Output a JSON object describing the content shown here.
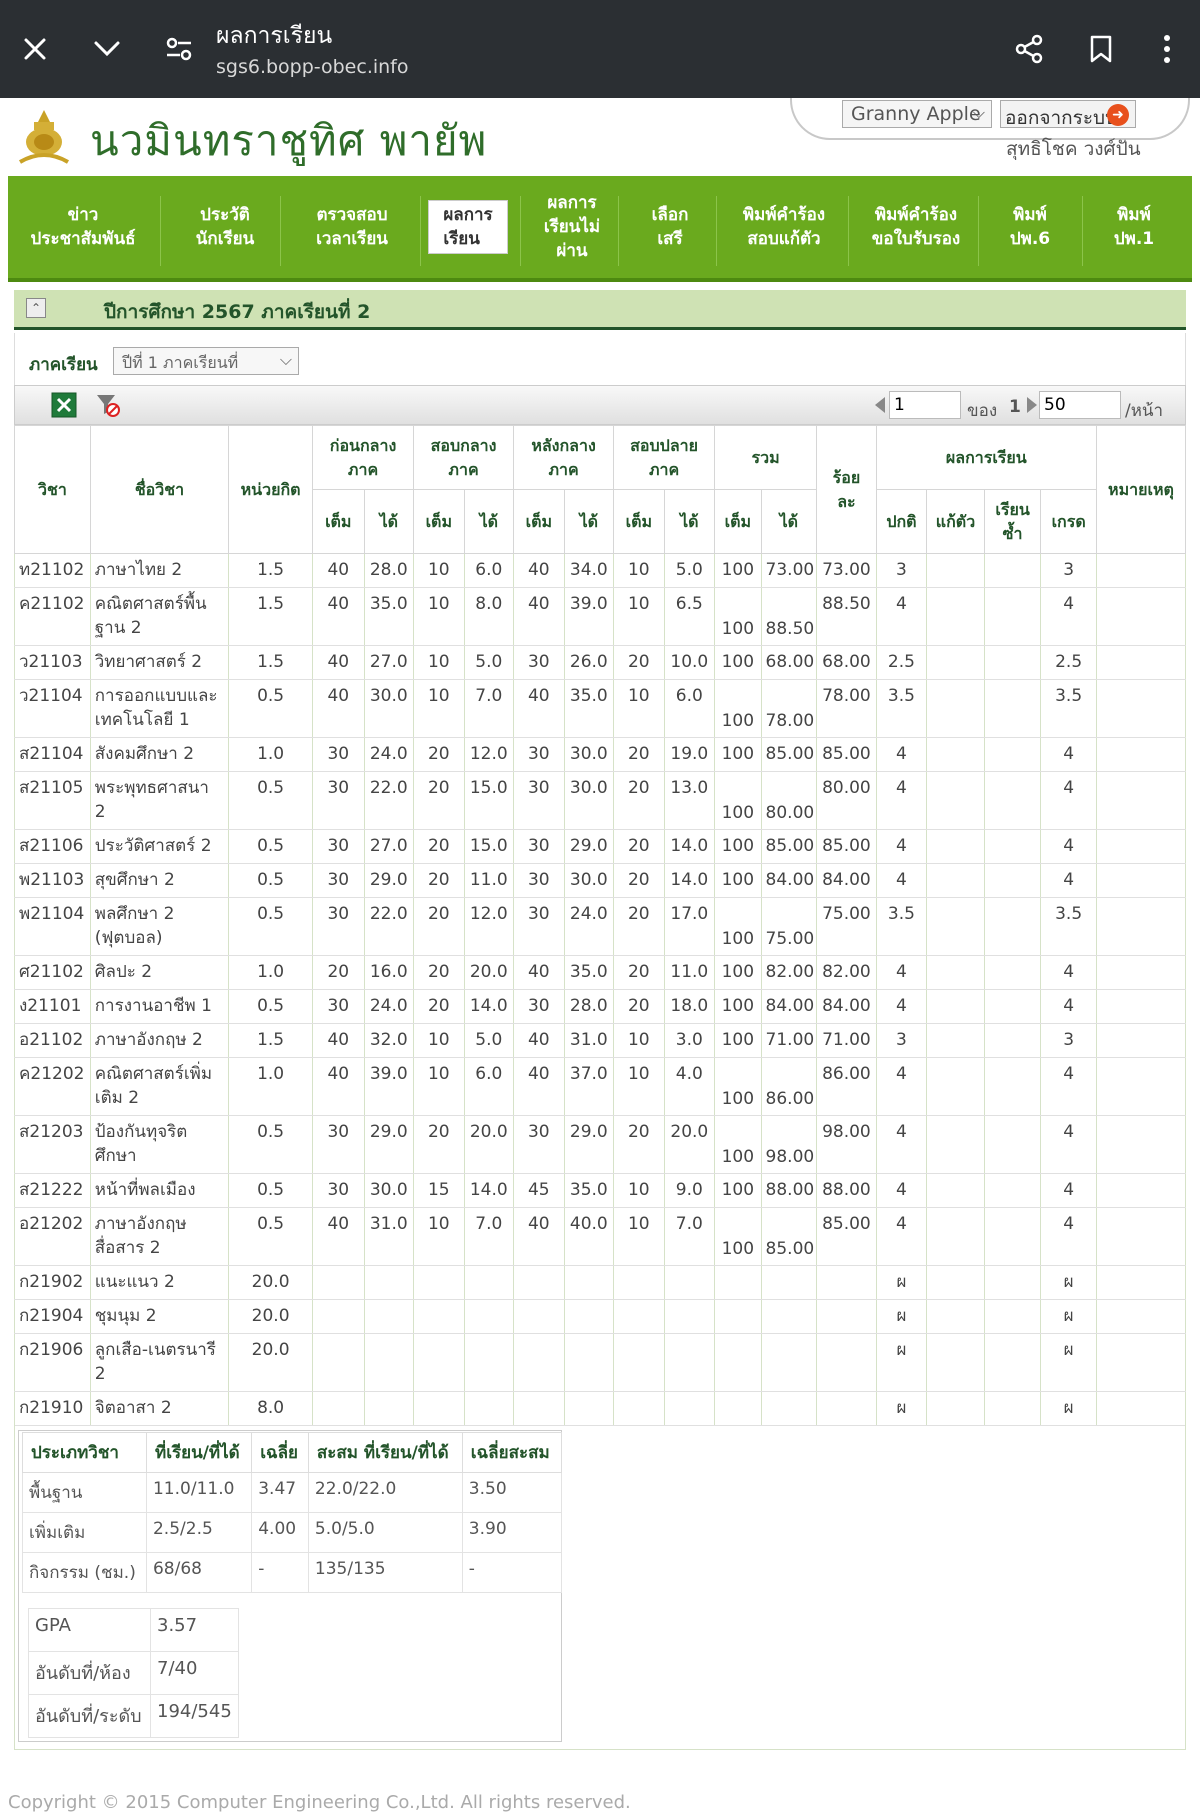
{
  "browser": {
    "title": "ผลการเรียน",
    "url": "sgs6.bopp-obec.info",
    "icons": [
      "close-icon",
      "chevron-down-icon",
      "page-settings-icon",
      "share-icon",
      "bookmark-icon",
      "more-vert-icon"
    ]
  },
  "header": {
    "school_name": "นวมินทราชูทิศ พายัพ",
    "theme": "Granny Apple",
    "logout_label": "ออกจากระบบ",
    "user_name": "สุทธิโชค วงศ์ปัน"
  },
  "nav": [
    {
      "label": "ข่าว\nประชาสัมพันธ์"
    },
    {
      "label": "ประวัติ\nนักเรียน"
    },
    {
      "label": "ตรวจสอบ\nเวลาเรียน"
    },
    {
      "label": "ผลการ\nเรียน",
      "active": true
    },
    {
      "label": "ผลการ\nเรียนไม่\nผ่าน"
    },
    {
      "label": "เลือก\nเสรี"
    },
    {
      "label": "พิมพ์คำร้อง\nสอบแก้ตัว"
    },
    {
      "label": "พิมพ์คำร้อง\nขอใบรับรอง"
    },
    {
      "label": "พิมพ์\nปพ.6"
    },
    {
      "label": "พิมพ์\nปพ.1"
    }
  ],
  "section": {
    "title": "ปีการศึกษา 2567 ภาคเรียนที่ 2",
    "term_label": "ภาคเรียน",
    "term_value": "ปีที่ 1 ภาคเรียนที่"
  },
  "pager": {
    "page": "1",
    "of_label": "ของ",
    "total": "1",
    "per_page": "50",
    "per_page_suffix": "/หน้า"
  },
  "table": {
    "headers": {
      "code": "วิชา",
      "name": "ชื่อวิชา",
      "credit": "หน่วยกิต",
      "pre_mid": "ก่อนกลาง\nภาค",
      "mid": "สอบกลาง\nภาค",
      "post_mid": "หลังกลาง\nภาค",
      "final": "สอบปลาย\nภาค",
      "total": "รวม",
      "percent": "ร้อย\nละ",
      "result": "ผลการเรียน",
      "remark": "หมายเหตุ",
      "full": "เต็ม",
      "got": "ได้",
      "normal": "ปกติ",
      "retest": "แก้ตัว",
      "repeat": "เรียน\nซ้ำ",
      "grade": "เกรด"
    },
    "rows": [
      {
        "code": "ท21102",
        "name": "ภาษาไทย 2",
        "credit": "1.5",
        "s": [
          "40",
          "28.0",
          "10",
          "6.0",
          "40",
          "34.0",
          "10",
          "5.0",
          "100",
          "73.00"
        ],
        "pct": "73.00",
        "normal": "3",
        "grade": "3",
        "two": false
      },
      {
        "code": "ค21102",
        "name": "คณิตศาสตร์พื้นฐาน 2",
        "credit": "1.5",
        "s": [
          "40",
          "35.0",
          "10",
          "8.0",
          "40",
          "39.0",
          "10",
          "6.5",
          "100",
          "88.50"
        ],
        "pct": "88.50",
        "normal": "4",
        "grade": "4",
        "two": true
      },
      {
        "code": "ว21103",
        "name": "วิทยาศาสตร์ 2",
        "credit": "1.5",
        "s": [
          "40",
          "27.0",
          "10",
          "5.0",
          "30",
          "26.0",
          "20",
          "10.0",
          "100",
          "68.00"
        ],
        "pct": "68.00",
        "normal": "2.5",
        "grade": "2.5",
        "two": false
      },
      {
        "code": "ว21104",
        "name": "การออกแบบและเทคโนโลยี 1",
        "credit": "0.5",
        "s": [
          "40",
          "30.0",
          "10",
          "7.0",
          "40",
          "35.0",
          "10",
          "6.0",
          "100",
          "78.00"
        ],
        "pct": "78.00",
        "normal": "3.5",
        "grade": "3.5",
        "two": true
      },
      {
        "code": "ส21104",
        "name": "สังคมศึกษา 2",
        "credit": "1.0",
        "s": [
          "30",
          "24.0",
          "20",
          "12.0",
          "30",
          "30.0",
          "20",
          "19.0",
          "100",
          "85.00"
        ],
        "pct": "85.00",
        "normal": "4",
        "grade": "4",
        "two": false
      },
      {
        "code": "ส21105",
        "name": "พระพุทธศาสนา 2",
        "credit": "0.5",
        "s": [
          "30",
          "22.0",
          "20",
          "15.0",
          "30",
          "30.0",
          "20",
          "13.0",
          "100",
          "80.00"
        ],
        "pct": "80.00",
        "normal": "4",
        "grade": "4",
        "two": true
      },
      {
        "code": "ส21106",
        "name": "ประวัติศาสตร์ 2",
        "credit": "0.5",
        "s": [
          "30",
          "27.0",
          "20",
          "15.0",
          "30",
          "29.0",
          "20",
          "14.0",
          "100",
          "85.00"
        ],
        "pct": "85.00",
        "normal": "4",
        "grade": "4",
        "two": false
      },
      {
        "code": "พ21103",
        "name": "สุขศึกษา 2",
        "credit": "0.5",
        "s": [
          "30",
          "29.0",
          "20",
          "11.0",
          "30",
          "30.0",
          "20",
          "14.0",
          "100",
          "84.00"
        ],
        "pct": "84.00",
        "normal": "4",
        "grade": "4",
        "two": false
      },
      {
        "code": "พ21104",
        "name": "พลศึกษา 2 (ฟุตบอล)",
        "credit": "0.5",
        "s": [
          "30",
          "22.0",
          "20",
          "12.0",
          "30",
          "24.0",
          "20",
          "17.0",
          "100",
          "75.00"
        ],
        "pct": "75.00",
        "normal": "3.5",
        "grade": "3.5",
        "two": true
      },
      {
        "code": "ศ21102",
        "name": "ศิลปะ 2",
        "credit": "1.0",
        "s": [
          "20",
          "16.0",
          "20",
          "20.0",
          "40",
          "35.0",
          "20",
          "11.0",
          "100",
          "82.00"
        ],
        "pct": "82.00",
        "normal": "4",
        "grade": "4",
        "two": false
      },
      {
        "code": "ง21101",
        "name": "การงานอาชีพ 1",
        "credit": "0.5",
        "s": [
          "30",
          "24.0",
          "20",
          "14.0",
          "30",
          "28.0",
          "20",
          "18.0",
          "100",
          "84.00"
        ],
        "pct": "84.00",
        "normal": "4",
        "grade": "4",
        "two": false
      },
      {
        "code": "อ21102",
        "name": "ภาษาอังกฤษ 2",
        "credit": "1.5",
        "s": [
          "40",
          "32.0",
          "10",
          "5.0",
          "40",
          "31.0",
          "10",
          "3.0",
          "100",
          "71.00"
        ],
        "pct": "71.00",
        "normal": "3",
        "grade": "3",
        "two": false
      },
      {
        "code": "ค21202",
        "name": "คณิตศาสตร์เพิ่มเติม 2",
        "credit": "1.0",
        "s": [
          "40",
          "39.0",
          "10",
          "6.0",
          "40",
          "37.0",
          "10",
          "4.0",
          "100",
          "86.00"
        ],
        "pct": "86.00",
        "normal": "4",
        "grade": "4",
        "two": true
      },
      {
        "code": "ส21203",
        "name": "ป้องกันทุจริตศึกษา",
        "credit": "0.5",
        "s": [
          "30",
          "29.0",
          "20",
          "20.0",
          "30",
          "29.0",
          "20",
          "20.0",
          "100",
          "98.00"
        ],
        "pct": "98.00",
        "normal": "4",
        "grade": "4",
        "two": true
      },
      {
        "code": "ส21222",
        "name": "หน้าที่พลเมือง",
        "credit": "0.5",
        "s": [
          "30",
          "30.0",
          "15",
          "14.0",
          "45",
          "35.0",
          "10",
          "9.0",
          "100",
          "88.00"
        ],
        "pct": "88.00",
        "normal": "4",
        "grade": "4",
        "two": false
      },
      {
        "code": "อ21202",
        "name": "ภาษาอังกฤษสื่อสาร 2",
        "credit": "0.5",
        "s": [
          "40",
          "31.0",
          "10",
          "7.0",
          "40",
          "40.0",
          "10",
          "7.0",
          "100",
          "85.00"
        ],
        "pct": "85.00",
        "normal": "4",
        "grade": "4",
        "two": true
      },
      {
        "code": "ก21902",
        "name": "แนะแนว 2",
        "credit": "20.0",
        "s": [
          "",
          "",
          "",
          "",
          "",
          "",
          "",
          "",
          "",
          ""
        ],
        "pct": "",
        "normal": "ผ",
        "grade": "ผ",
        "two": false
      },
      {
        "code": "ก21904",
        "name": "ชุมนุม 2",
        "credit": "20.0",
        "s": [
          "",
          "",
          "",
          "",
          "",
          "",
          "",
          "",
          "",
          ""
        ],
        "pct": "",
        "normal": "ผ",
        "grade": "ผ",
        "two": false
      },
      {
        "code": "ก21906",
        "name": "ลูกเสือ-เนตรนารี 2",
        "credit": "20.0",
        "s": [
          "",
          "",
          "",
          "",
          "",
          "",
          "",
          "",
          "",
          ""
        ],
        "pct": "",
        "normal": "ผ",
        "grade": "ผ",
        "two": true
      },
      {
        "code": "ก21910",
        "name": "จิตอาสา 2",
        "credit": "8.0",
        "s": [
          "",
          "",
          "",
          "",
          "",
          "",
          "",
          "",
          "",
          ""
        ],
        "pct": "",
        "normal": "ผ",
        "grade": "ผ",
        "two": false
      }
    ]
  },
  "summary": {
    "headers": [
      "ประเภทวิชา",
      "ที่เรียน/ที่ได้",
      "เฉลี่ย",
      "สะสม ที่เรียน/ที่ได้",
      "เฉลี่ยสะสม"
    ],
    "rows": [
      [
        "พื้นฐาน",
        "11.0/11.0",
        "3.47",
        "22.0/22.0",
        "3.50"
      ],
      [
        "เพิ่มเติม",
        "2.5/2.5",
        "4.00",
        "5.0/5.0",
        "3.90"
      ],
      [
        "กิจกรรม (ชม.)",
        "68/68",
        "-",
        "135/135",
        "-"
      ]
    ],
    "gpa": [
      [
        "GPA",
        "3.57"
      ],
      [
        "อันดับที่/ห้อง",
        "7/40"
      ],
      [
        "อันดับที่/ระดับ",
        "194/545"
      ]
    ]
  },
  "footer": "Copyright © 2015 Computer Engineering Co.,Ltd. All rights reserved."
}
